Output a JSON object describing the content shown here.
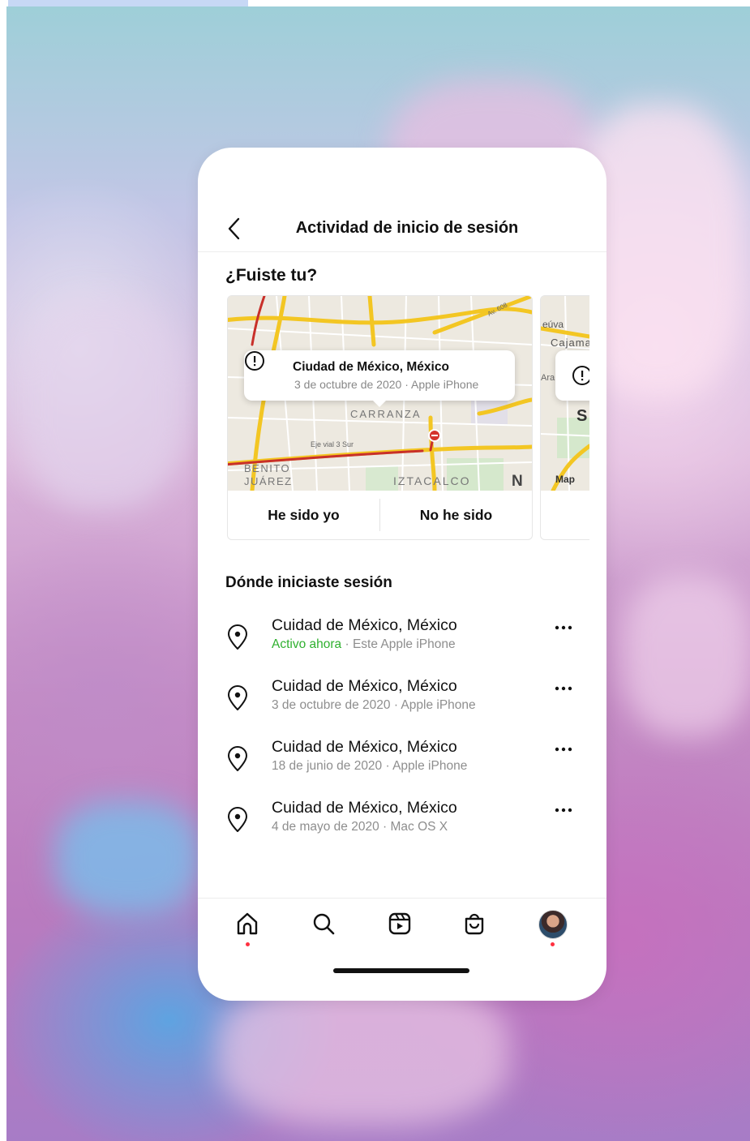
{
  "header": {
    "title": "Actividad de inicio de sesión"
  },
  "prompt": {
    "title": "¿Fuiste tu?",
    "card": {
      "place": "Ciudad de México, México",
      "meta": "3 de octubre de 2020 · Apple iPhone",
      "map_labels": [
        "CARRANZA",
        "Eje vial 3 Sur",
        "BENITO",
        "JUÁREZ",
        "IZTACALCO",
        "Av. 608",
        "N"
      ],
      "yes_button": "He sido yo",
      "no_button": "No he sido"
    },
    "next_card_map_labels": [
      "eúva",
      "Cajama",
      "Ara",
      "S",
      "Map"
    ]
  },
  "sessions": {
    "title": "Dónde iniciaste sesión",
    "items": [
      {
        "place": "Cuidad de México, México",
        "active": "Activo ahora",
        "meta": " · Este Apple iPhone"
      },
      {
        "place": "Cuidad de México, México",
        "meta": "3 de octubre de 2020 · Apple iPhone"
      },
      {
        "place": "Cuidad de México, México",
        "meta": "18 de junio de 2020 · Apple iPhone"
      },
      {
        "place": "Cuidad de México, México",
        "meta": "4 de mayo de 2020 · Mac OS X"
      }
    ]
  },
  "tabbar": {
    "items": [
      "home-icon",
      "search-icon",
      "reels-icon",
      "shop-icon",
      "profile-avatar"
    ]
  },
  "colors": {
    "active_green": "#2fb02f",
    "notification_dot": "#ff3040",
    "map_road_major": "#f3c623",
    "map_road_red": "#c8302a"
  }
}
